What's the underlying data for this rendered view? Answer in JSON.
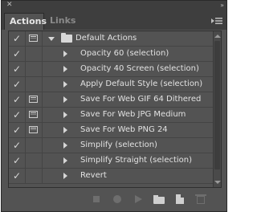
{
  "panel": {
    "tabs": [
      {
        "label": "Actions",
        "active": true
      },
      {
        "label": "Links",
        "active": false
      }
    ]
  },
  "action_set": {
    "label": "Default Actions",
    "enabled": true,
    "has_dialog": true,
    "expanded": true
  },
  "actions": [
    {
      "label": "Opacity 60 (selection)",
      "enabled": true,
      "has_dialog": false
    },
    {
      "label": "Opacity 40 Screen (selection)",
      "enabled": true,
      "has_dialog": false
    },
    {
      "label": "Apply Default Style (selection)",
      "enabled": true,
      "has_dialog": false
    },
    {
      "label": "Save For Web GIF 64 Dithered",
      "enabled": true,
      "has_dialog": true
    },
    {
      "label": "Save For Web JPG Medium",
      "enabled": true,
      "has_dialog": true
    },
    {
      "label": "Save For Web PNG 24",
      "enabled": true,
      "has_dialog": true
    },
    {
      "label": "Simplify (selection)",
      "enabled": true,
      "has_dialog": false
    },
    {
      "label": "Simplify Straight (selection)",
      "enabled": true,
      "has_dialog": false
    },
    {
      "label": "Revert",
      "enabled": true,
      "has_dialog": false
    }
  ],
  "icons": {
    "check": "✓",
    "close": "✕",
    "collapse": "»",
    "menu": "panel-menu-icon"
  },
  "colors": {
    "panel_bg": "#535353",
    "tab_bar_bg": "#3e3e3e",
    "text": "#e2e2e2"
  }
}
